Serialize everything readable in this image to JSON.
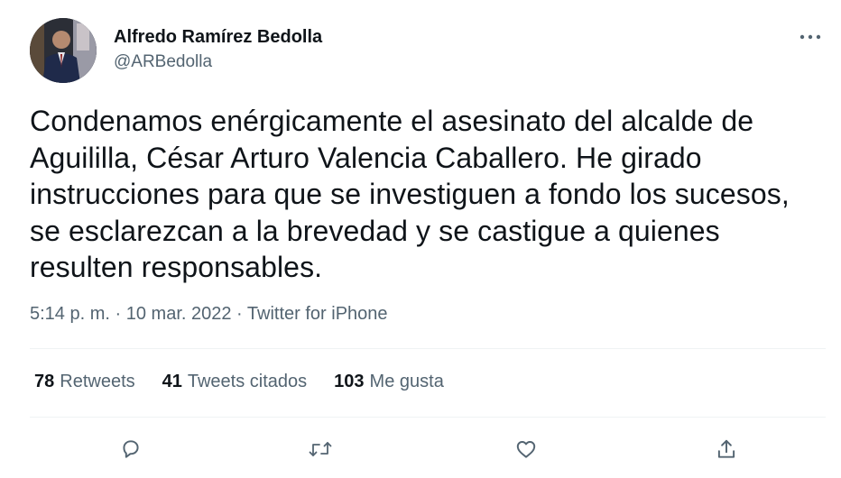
{
  "author": {
    "display_name": "Alfredo Ramírez Bedolla",
    "handle": "@ARBedolla"
  },
  "tweet": {
    "text": "Condenamos enérgicamente el asesinato del alcalde de Aguililla, César Arturo Valencia Caballero. He girado instrucciones para que se investiguen a fondo los sucesos, se esclarezcan a la brevedad y se castigue a quienes resulten responsables.",
    "time": "5:14 p. m.",
    "separator": "·",
    "date": "10 mar. 2022",
    "source": "Twitter for iPhone"
  },
  "stats": {
    "retweets": {
      "count": "78",
      "label": "Retweets"
    },
    "quotes": {
      "count": "41",
      "label": "Tweets citados"
    },
    "likes": {
      "count": "103",
      "label": "Me gusta"
    }
  },
  "icons": {
    "more": "more-horizontal-icon",
    "reply": "reply-icon",
    "retweet": "retweet-icon",
    "like": "heart-icon",
    "share": "share-icon"
  },
  "colors": {
    "text": "#0f1419",
    "secondary": "#536471",
    "divider": "#eff3f4"
  }
}
